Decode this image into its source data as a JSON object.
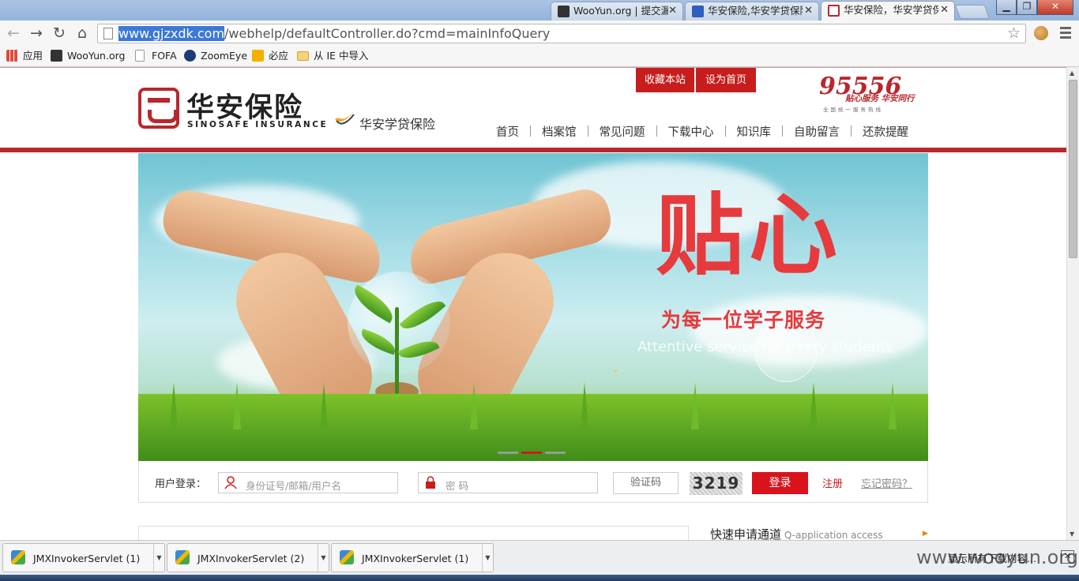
{
  "browser": {
    "tabs": [
      {
        "label": "WooYun.org | 提交漏",
        "active": false
      },
      {
        "label": "华安保险,华安学贷保险",
        "active": false
      },
      {
        "label": "华安保险，华安学贷保",
        "active": true
      }
    ],
    "address": {
      "host": "www.gjzxdk.com",
      "path": "/webhelp/defaultController.do?cmd=mainInfoQuery"
    },
    "bookmarks": [
      "应用",
      "WooYun.org",
      "FOFA",
      "ZoomEye",
      "必应",
      "从 IE 中导入"
    ]
  },
  "site": {
    "top_buttons": [
      "收藏本站",
      "设为首页"
    ],
    "logo_cn": "华安保险",
    "logo_en": "SINOSAFE INSURANCE",
    "sub_brand": "华安学贷保险",
    "hotline": {
      "number": "95556",
      "slogan": "贴心服务 华安同行",
      "sub": "全国统一服务热线"
    },
    "nav": [
      "首页",
      "档案馆",
      "常见问题",
      "下载中心",
      "知识库",
      "自助留言",
      "还款提醒"
    ]
  },
  "banner": {
    "title": "贴心",
    "subtitle": "为每一位学子服务",
    "english": "Attentive service for every students",
    "slide_count": 3,
    "active_slide": 2
  },
  "login": {
    "label": "用户登录：",
    "username_placeholder": "身份证号/邮箱/用户名",
    "password_placeholder": "密 码",
    "captcha_placeholder": "验证码",
    "captcha_value": "3219",
    "login_button": "登录",
    "register_link": "注册",
    "forgot_link": "忘记密码？"
  },
  "quick_apply": {
    "title": "快速申请通道",
    "subtitle": "Q-application access"
  },
  "downloads": {
    "items": [
      "JMXInvokerServlet (1)",
      "JMXInvokerServlet (2)",
      "JMXInvokerServlet (1)"
    ],
    "show_all": "显示所有下载内容..."
  },
  "watermark": "www.wooyun.org",
  "colors": {
    "brand_red": "#b9272c",
    "button_red": "#d9121c",
    "banner_text_red": "#e63a3d",
    "url_highlight": "#3b78d8"
  }
}
